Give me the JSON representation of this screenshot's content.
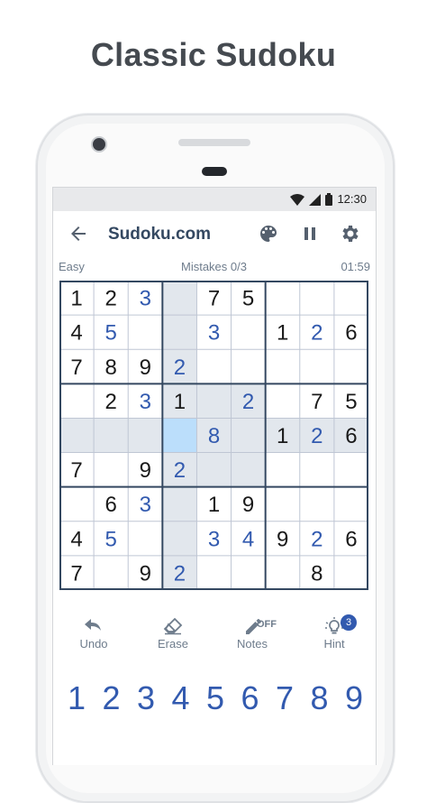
{
  "headline": "Classic Sudoku",
  "status_bar": {
    "time": "12:30"
  },
  "app_bar": {
    "title": "Sudoku.com",
    "back_icon": "arrow-left-icon",
    "actions": [
      "palette-icon",
      "pause-icon",
      "gear-icon"
    ]
  },
  "game_info": {
    "difficulty": "Easy",
    "mistakes": "Mistakes 0/3",
    "timer": "01:59"
  },
  "board": {
    "cells": [
      [
        "1",
        "2",
        "3",
        "",
        "7",
        "5",
        "",
        "",
        ""
      ],
      [
        "4",
        "5",
        "",
        "",
        "3",
        "",
        "1",
        "2",
        "6"
      ],
      [
        "7",
        "8",
        "9",
        "2",
        "",
        "",
        "",
        "",
        ""
      ],
      [
        "",
        "2",
        "3",
        "1",
        "",
        "2",
        "",
        "7",
        "5"
      ],
      [
        "",
        "",
        "",
        "",
        "8",
        "",
        "1",
        "2",
        "6"
      ],
      [
        "7",
        "",
        "9",
        "2",
        "",
        "",
        "",
        "",
        ""
      ],
      [
        "",
        "6",
        "3",
        "",
        "1",
        "9",
        "",
        "",
        ""
      ],
      [
        "4",
        "5",
        "",
        "",
        "3",
        "4",
        "9",
        "2",
        "6"
      ],
      [
        "7",
        "",
        "9",
        "2",
        "",
        "",
        "",
        "8",
        ""
      ]
    ],
    "user_entered": [
      [
        0,
        2
      ],
      [
        1,
        1
      ],
      [
        1,
        4
      ],
      [
        1,
        7
      ],
      [
        2,
        3
      ],
      [
        3,
        2
      ],
      [
        3,
        5
      ],
      [
        4,
        4
      ],
      [
        4,
        7
      ],
      [
        5,
        3
      ],
      [
        6,
        2
      ],
      [
        7,
        1
      ],
      [
        7,
        4
      ],
      [
        7,
        5
      ],
      [
        7,
        7
      ],
      [
        8,
        3
      ]
    ],
    "selected_cell": [
      4,
      3
    ],
    "colors": {
      "given": "#1a1a1a",
      "user": "#325aaf",
      "selected": "#bbdefb",
      "highlight": "#e2e7ed",
      "thin_line": "#bfc6d4",
      "thick_line": "#344861"
    }
  },
  "tools": {
    "undo": {
      "label": "Undo",
      "icon": "undo-icon"
    },
    "erase": {
      "label": "Erase",
      "icon": "eraser-icon"
    },
    "notes": {
      "label": "Notes",
      "icon": "pencil-icon",
      "state": "OFF"
    },
    "hint": {
      "label": "Hint",
      "icon": "lightbulb-icon",
      "count": "3"
    }
  },
  "numpad": [
    "1",
    "2",
    "3",
    "4",
    "5",
    "6",
    "7",
    "8",
    "9"
  ]
}
